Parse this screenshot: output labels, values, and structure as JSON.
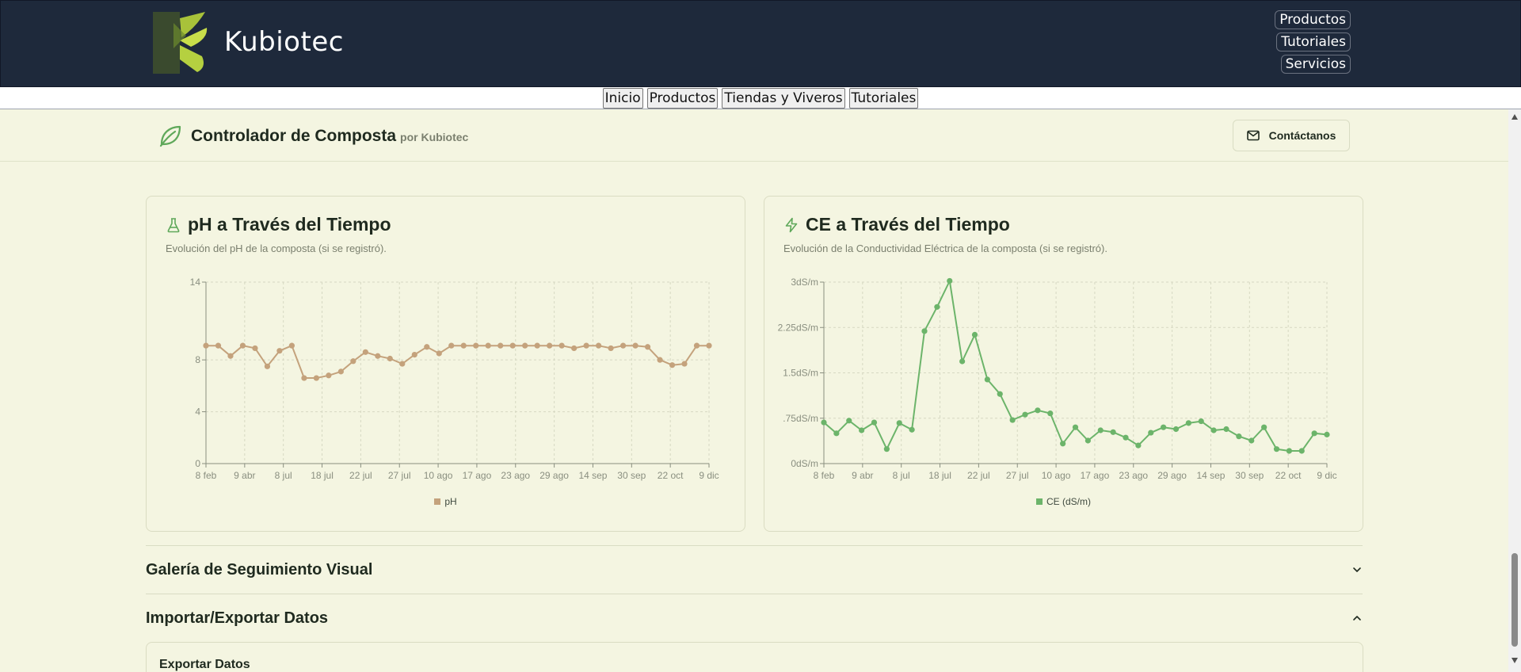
{
  "site": {
    "brand": "Kubiotec",
    "top_nav": [
      "Productos",
      "Tutoriales",
      "Servicios"
    ],
    "sub_nav": [
      "Inicio",
      "Productos",
      "Tiendas y Viveros",
      "Tutoriales"
    ]
  },
  "app": {
    "title": "Controlador de Composta",
    "subtitle": "por Kubiotec",
    "contact_label": "Contáctanos"
  },
  "ph_card": {
    "title": "pH a Través del Tiempo",
    "description": "Evolución del pH de la composta (si se registró).",
    "legend": "pH"
  },
  "ce_card": {
    "title": "CE a Través del Tiempo",
    "description": "Evolución de la Conductividad Eléctrica de la composta (si se registró).",
    "legend": "CE (dS/m)"
  },
  "sections": {
    "gallery": "Galería de Seguimiento Visual",
    "import_export": "Importar/Exportar Datos",
    "export_heading": "Exportar Datos"
  },
  "colors": {
    "header_bg": "#1e293b",
    "app_bg": "#f4f5e1",
    "ph_series": "#c4a27c",
    "ce_series": "#6cb46a",
    "accent_green": "#5fa85a"
  },
  "chart_data": [
    {
      "type": "line",
      "title": "pH a Través del Tiempo",
      "x_tick_labels": [
        "8 feb",
        "9 abr",
        "8 jul",
        "18 jul",
        "22 jul",
        "27 jul",
        "10 ago",
        "17 ago",
        "23 ago",
        "29 ago",
        "14 sep",
        "30 sep",
        "22 oct",
        "9 dic"
      ],
      "y_tick_labels": [
        "0",
        "4",
        "8",
        "14"
      ],
      "ylim": [
        0,
        14
      ],
      "grid": true,
      "legend_position": "bottom",
      "series": [
        {
          "name": "pH",
          "values": [
            9.1,
            9.1,
            8.3,
            9.1,
            8.9,
            7.5,
            8.7,
            9.1,
            6.6,
            6.6,
            6.8,
            7.1,
            7.9,
            8.6,
            8.3,
            8.1,
            7.7,
            8.4,
            9.0,
            8.5,
            9.1,
            9.1,
            9.1,
            9.1,
            9.1,
            9.1,
            9.1,
            9.1,
            9.1,
            9.1,
            8.9,
            9.1,
            9.1,
            8.9,
            9.1,
            9.1,
            9.0,
            8.0,
            7.6,
            7.7,
            9.1,
            9.1
          ]
        }
      ]
    },
    {
      "type": "line",
      "title": "CE a Través del Tiempo",
      "x_tick_labels": [
        "8 feb",
        "9 abr",
        "8 jul",
        "18 jul",
        "22 jul",
        "27 jul",
        "10 ago",
        "17 ago",
        "23 ago",
        "29 ago",
        "14 sep",
        "30 sep",
        "22 oct",
        "9 dic"
      ],
      "y_tick_labels": [
        "0dS/m",
        ".75dS/m",
        "1.5dS/m",
        "2.25dS/m",
        "3dS/m"
      ],
      "ylim": [
        0,
        3
      ],
      "grid": true,
      "legend_position": "bottom",
      "series": [
        {
          "name": "CE (dS/m)",
          "values": [
            0.68,
            0.5,
            0.71,
            0.55,
            0.68,
            0.24,
            0.67,
            0.56,
            2.19,
            2.59,
            3.02,
            1.69,
            2.13,
            1.39,
            1.15,
            0.72,
            0.81,
            0.88,
            0.83,
            0.33,
            0.6,
            0.38,
            0.55,
            0.52,
            0.43,
            0.3,
            0.51,
            0.6,
            0.57,
            0.67,
            0.7,
            0.55,
            0.57,
            0.45,
            0.38,
            0.6,
            0.24,
            0.21,
            0.21,
            0.5,
            0.48
          ]
        }
      ]
    }
  ]
}
